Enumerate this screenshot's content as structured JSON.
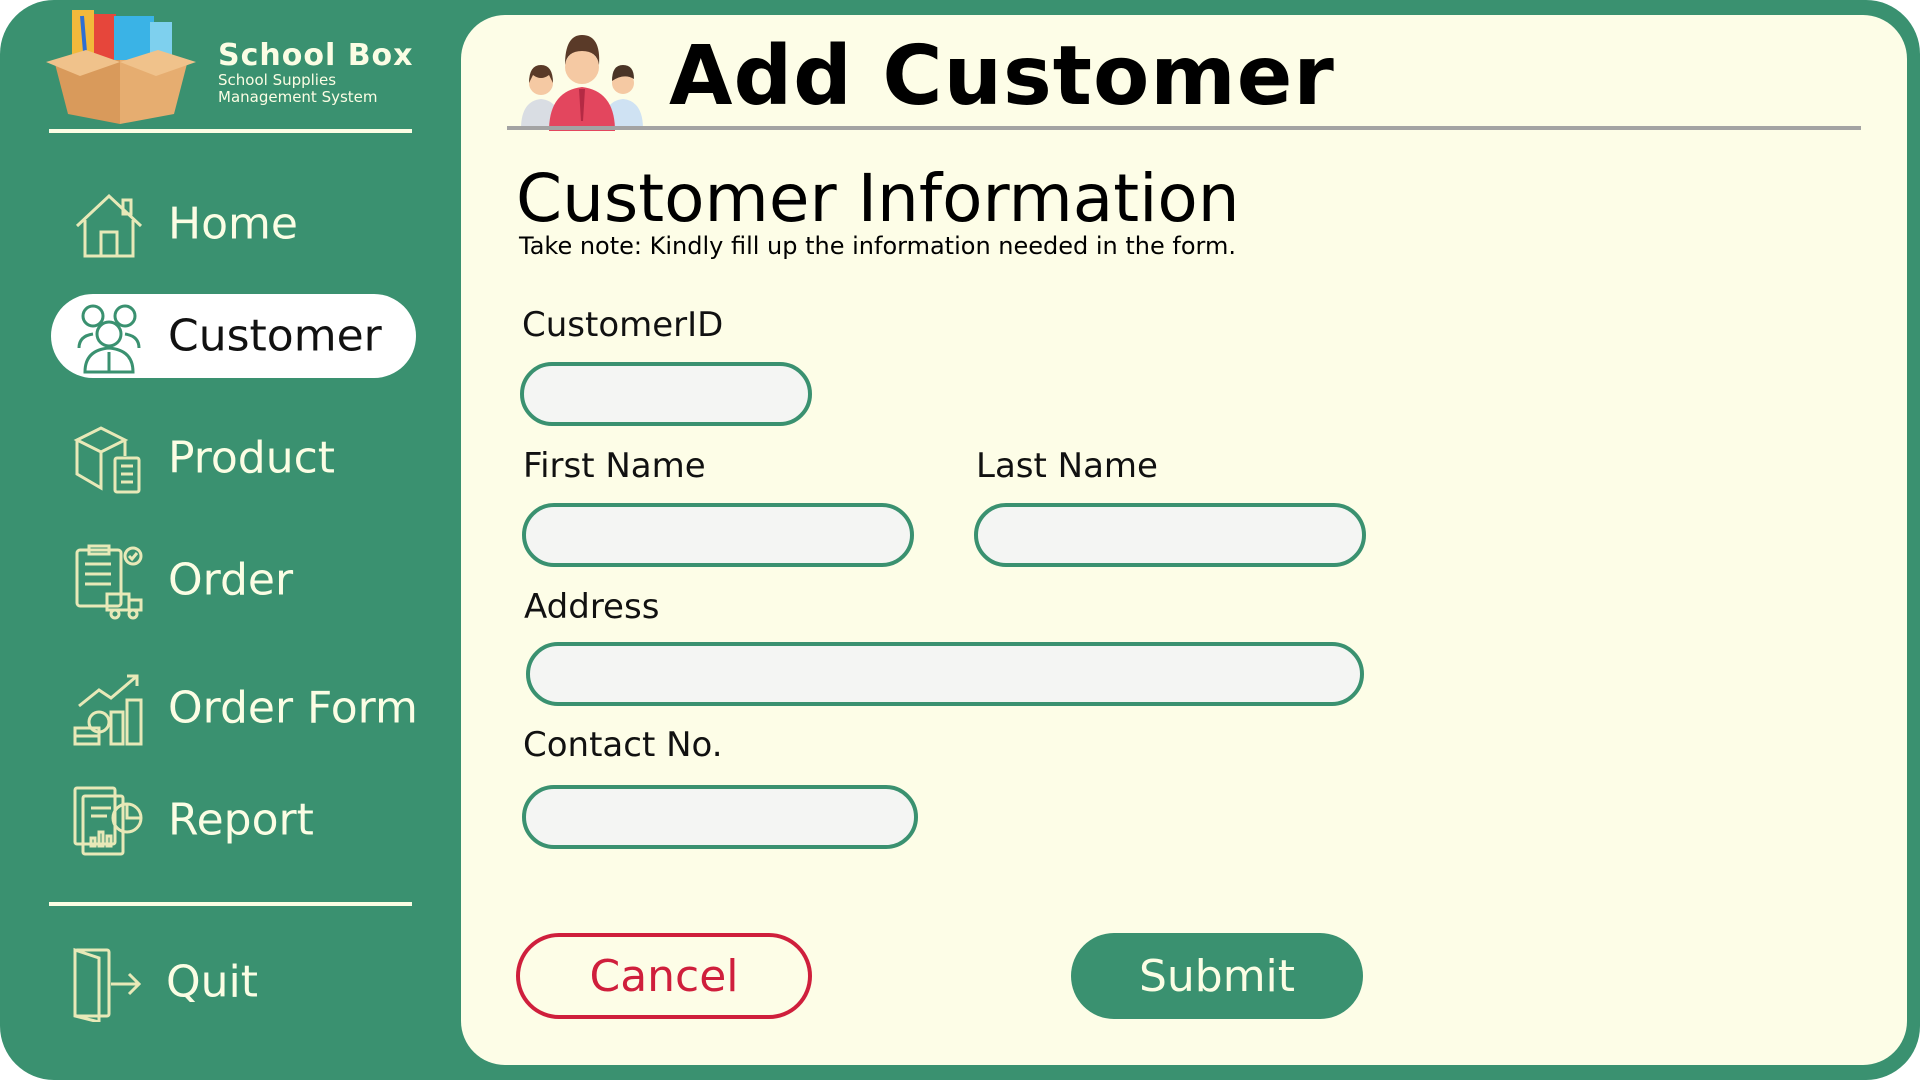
{
  "brand": {
    "title": "School Box",
    "subtitle_line1": "School Supplies",
    "subtitle_line2": "Management System",
    "logo_icon": "school-supplies-box-icon"
  },
  "sidebar": {
    "items": [
      {
        "label": "Home",
        "icon": "home-icon",
        "active": false
      },
      {
        "label": "Customer",
        "icon": "customers-icon",
        "active": true
      },
      {
        "label": "Product",
        "icon": "product-box-icon",
        "active": false
      },
      {
        "label": "Order",
        "icon": "order-clipboard-icon",
        "active": false
      },
      {
        "label": "Order Form",
        "icon": "order-form-chart-icon",
        "active": false
      },
      {
        "label": "Report",
        "icon": "report-icon",
        "active": false
      }
    ],
    "quit": {
      "label": "Quit",
      "icon": "exit-door-icon"
    }
  },
  "header": {
    "title": "Add Customer",
    "icon": "customer-group-icon"
  },
  "form": {
    "section_title": "Customer Information",
    "note": "Take note: Kindly fill up the information needed in the form.",
    "fields": {
      "customer_id": {
        "label": "CustomerID",
        "value": ""
      },
      "first_name": {
        "label": "First Name",
        "value": ""
      },
      "last_name": {
        "label": "Last Name",
        "value": ""
      },
      "address": {
        "label": "Address",
        "value": ""
      },
      "contact_no": {
        "label": "Contact No.",
        "value": ""
      }
    },
    "cancel_label": "Cancel",
    "submit_label": "Submit"
  },
  "colors": {
    "sidebar_bg": "#3a9170",
    "panel_bg": "#fdfde7",
    "accent": "#3a9170",
    "cancel": "#cf1f3c",
    "nav_text": "#fbfde4"
  }
}
